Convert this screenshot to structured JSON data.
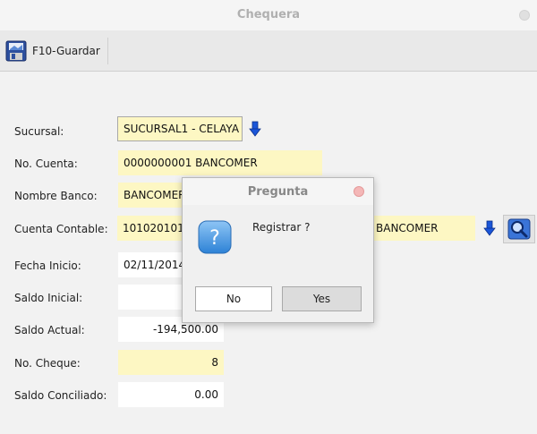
{
  "window": {
    "title": "Chequera"
  },
  "toolbar": {
    "save_label": "F10-Guardar"
  },
  "form": {
    "sucursal": {
      "label": "Sucursal:",
      "value": "SUCURSAL1 - CELAYA"
    },
    "no_cuenta": {
      "label": "No. Cuenta:",
      "value": "0000000001 BANCOMER"
    },
    "nombre_banco": {
      "label": "Nombre Banco:",
      "value": "BANCOMER"
    },
    "cuenta_contable": {
      "label": "Cuenta Contable:",
      "value": "101020101",
      "value_right": "BANCOMER"
    },
    "fecha_inicio": {
      "label": "Fecha Inicio:",
      "value": "02/11/2014"
    },
    "saldo_inicial": {
      "label": "Saldo Inicial:",
      "value": ""
    },
    "saldo_actual": {
      "label": "Saldo Actual:",
      "value": "-194,500.00"
    },
    "no_cheque": {
      "label": "No. Cheque:",
      "value": "8"
    },
    "saldo_conciliado": {
      "label": "Saldo Conciliado:",
      "value": "0.00"
    }
  },
  "dialog": {
    "title": "Pregunta",
    "message": "Registrar ?",
    "no_label": "No",
    "yes_label": "Yes"
  },
  "colors": {
    "highlight_field": "#fdf7c3",
    "arrow_blue": "#1a55d8",
    "dialog_close": "#f4b7b7"
  }
}
